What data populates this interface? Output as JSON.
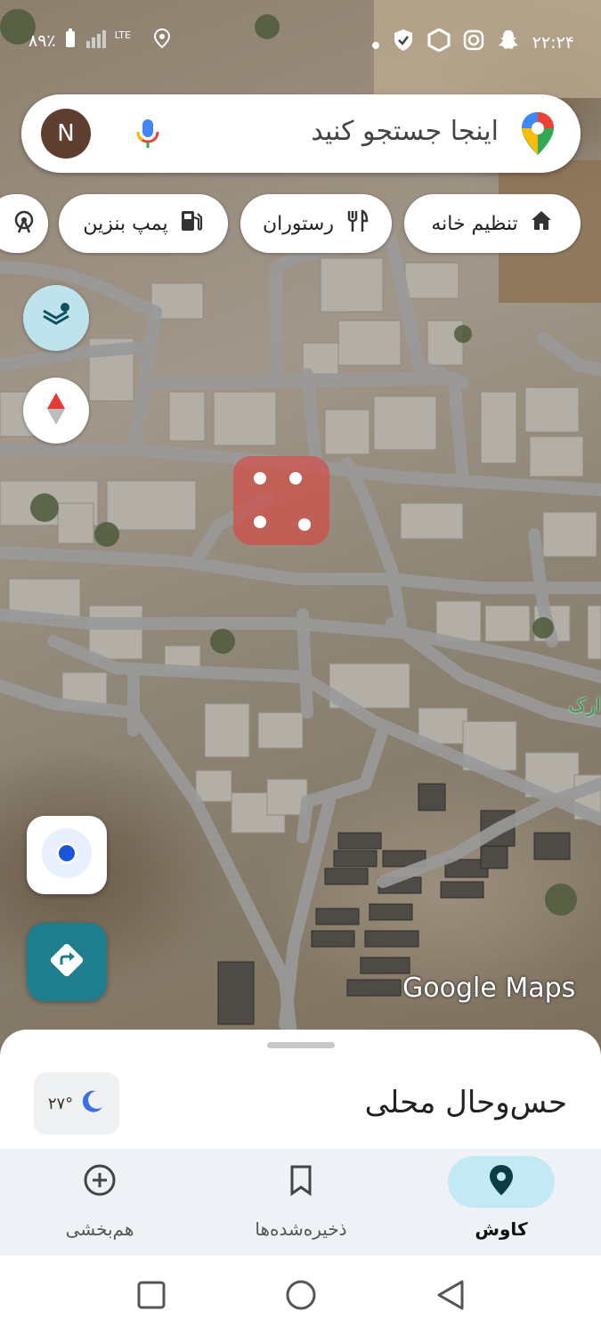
{
  "status_bar": {
    "battery": "۸۹٪",
    "network": "LTE",
    "time": "۲۲:۲۴",
    "icons": [
      "battery-icon",
      "signal-icon",
      "location-icon",
      "dot-icon",
      "shield-check-icon",
      "hexagon-icon",
      "instagram-icon",
      "snapchat-icon"
    ]
  },
  "search": {
    "avatar_initial": "N",
    "placeholder": "اینجا جستجو کنید"
  },
  "chips": [
    {
      "label": "تنظیم خانه",
      "icon": "home-icon"
    },
    {
      "label": "رستوران",
      "icon": "restaurant-icon"
    },
    {
      "label": "پمپ بنزین",
      "icon": "gas-station-icon"
    }
  ],
  "map": {
    "watermark": "Google Maps",
    "edge_label": "ارک",
    "colors": {
      "road": "#9a9a9a",
      "marker": "#e53935",
      "accent": "#1f7e8e"
    }
  },
  "sheet": {
    "title": "حس‌وحال محلی",
    "weather_temp": "۲۷°"
  },
  "bottom_nav": [
    {
      "label": "کاوش",
      "icon": "explore-pin-icon",
      "active": true
    },
    {
      "label": "ذخیره‌شده‌ها",
      "icon": "bookmark-icon",
      "active": false
    },
    {
      "label": "هم‌بخشی",
      "icon": "add-circle-icon",
      "active": false
    }
  ]
}
